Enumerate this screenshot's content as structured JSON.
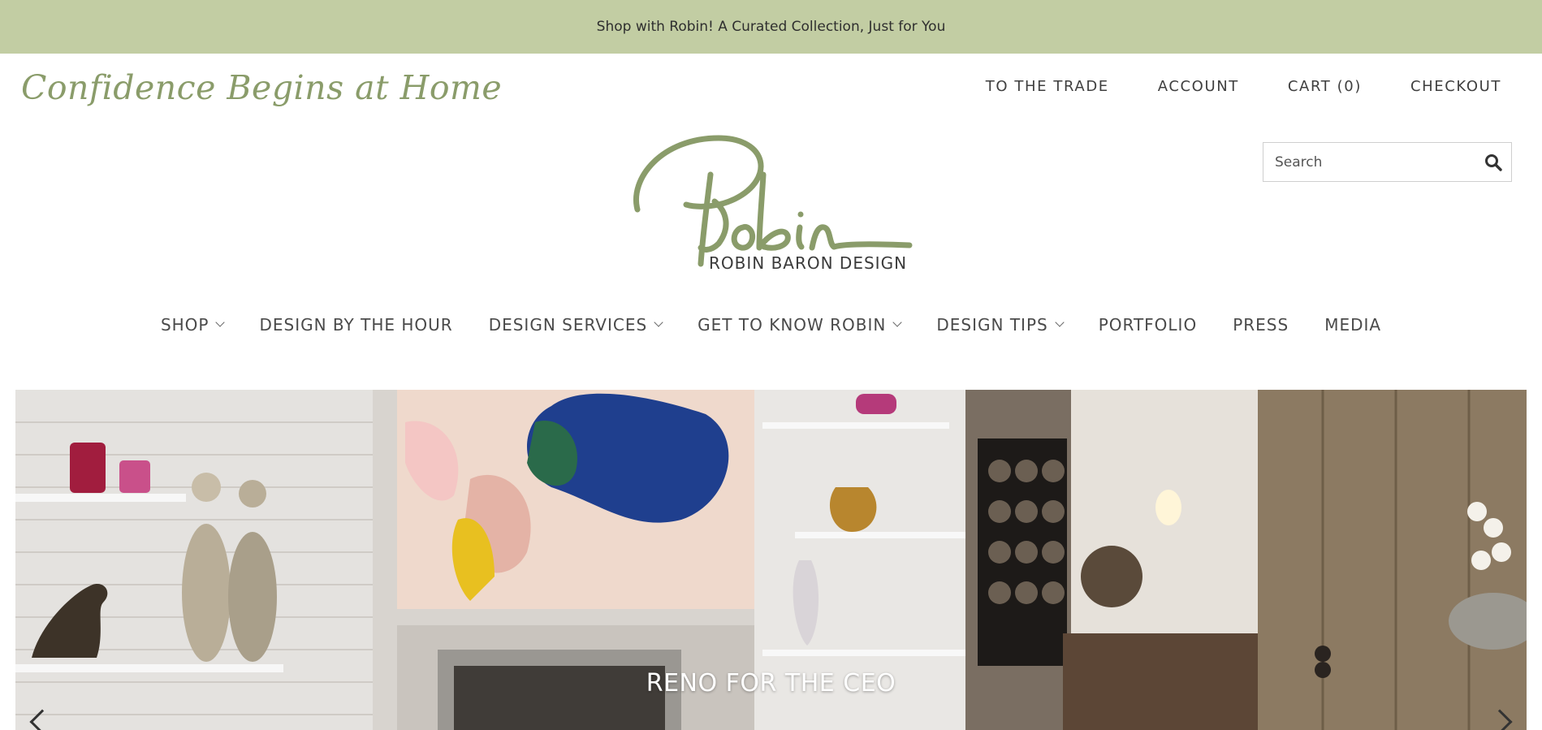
{
  "announcement": {
    "text": "Shop with Robin! A Curated Collection, Just for You"
  },
  "header": {
    "tagline": "Confidence Begins at Home",
    "utility_nav": [
      "TO THE TRADE",
      "ACCOUNT",
      "CART (0)",
      "CHECKOUT"
    ],
    "search": {
      "placeholder": "Search",
      "value": ""
    },
    "logo": {
      "script_text": "Robin",
      "subtitle": "ROBIN BARON DESIGN"
    }
  },
  "main_nav": {
    "items": [
      {
        "label": "SHOP",
        "has_dropdown": true
      },
      {
        "label": "DESIGN BY THE HOUR",
        "has_dropdown": false
      },
      {
        "label": "DESIGN SERVICES",
        "has_dropdown": true
      },
      {
        "label": "GET TO KNOW ROBIN",
        "has_dropdown": true
      },
      {
        "label": "DESIGN TIPS",
        "has_dropdown": true
      },
      {
        "label": "PORTFOLIO",
        "has_dropdown": false
      },
      {
        "label": "PRESS",
        "has_dropdown": false
      },
      {
        "label": "MEDIA",
        "has_dropdown": false
      }
    ]
  },
  "hero": {
    "caption": "RENO FOR THE CEO"
  },
  "colors": {
    "accent_green": "#8a9c6a",
    "announce_bg": "#c2cda3",
    "text_dark": "#3b3b3b"
  },
  "icons": [
    "search-icon",
    "chevron-down-icon",
    "chevron-left-icon",
    "chevron-right-icon"
  ]
}
